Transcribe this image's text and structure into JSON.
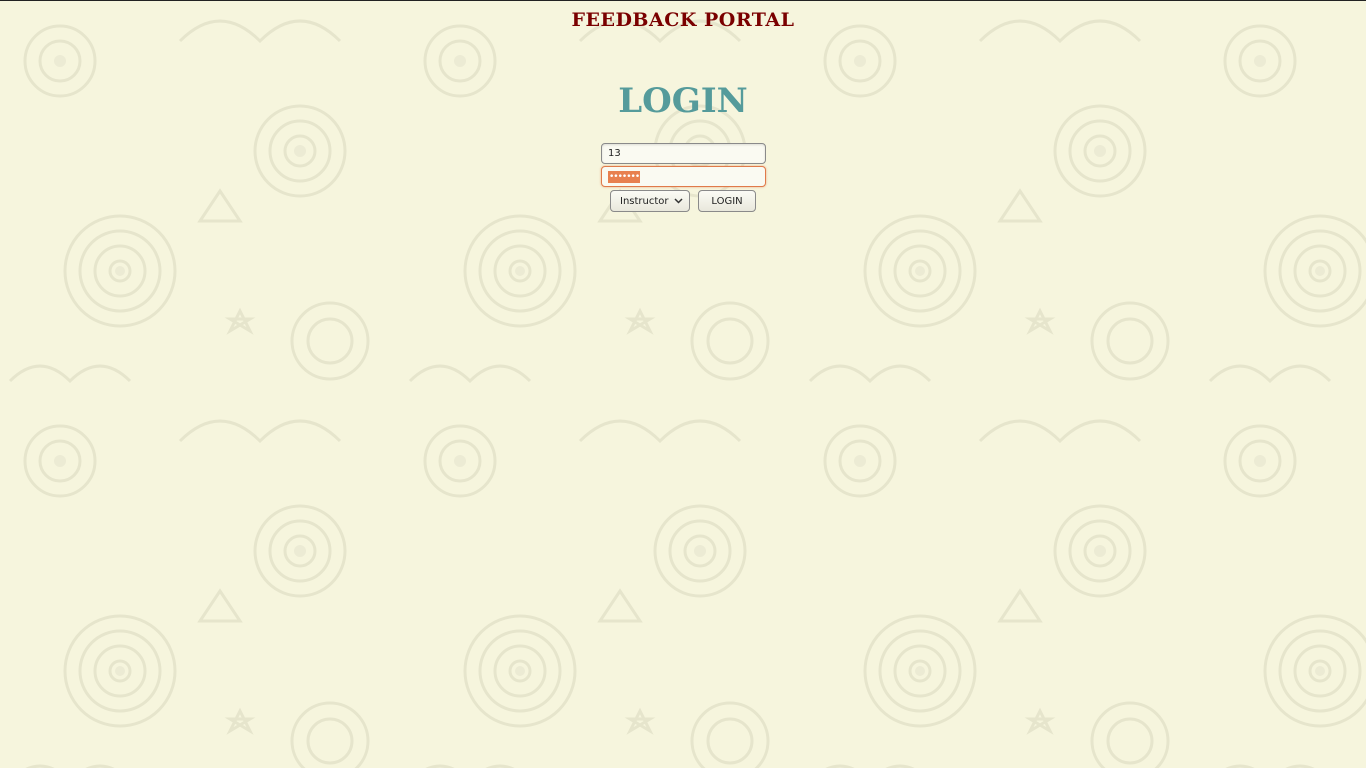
{
  "header": {
    "portal_title": "FEEDBACK PORTAL"
  },
  "login": {
    "heading": "LOGIN",
    "username_value": "13",
    "password_mask": "•••••••",
    "role_selected": "Instructor",
    "submit_label": "LOGIN"
  },
  "colors": {
    "background": "#f6f5dd",
    "pattern": "#e8e7ce",
    "portal_title": "#7a0000",
    "login_heading": "#559b9b",
    "password_focus": "#e07a4a"
  },
  "icons": {
    "dropdown": "chevron-down-icon"
  }
}
